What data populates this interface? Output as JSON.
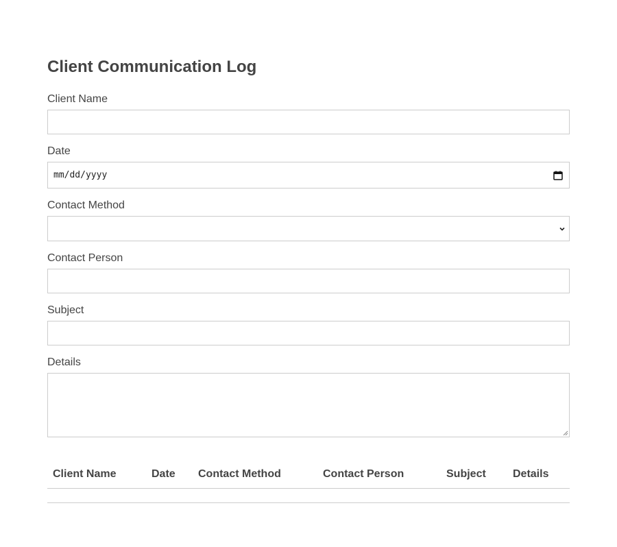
{
  "form": {
    "title": "Client Communication Log",
    "client_name_label": "Client Name",
    "client_name_value": "",
    "date_label": "Date",
    "date_placeholder": "mm/dd/yyyy",
    "contact_method_label": "Contact Method",
    "contact_method_value": "",
    "contact_person_label": "Contact Person",
    "contact_person_value": "",
    "subject_label": "Subject",
    "subject_value": "",
    "details_label": "Details",
    "details_value": ""
  },
  "table": {
    "headers": [
      "Client Name",
      "Date",
      "Contact Method",
      "Contact Person",
      "Subject",
      "Details"
    ],
    "rows": []
  },
  "icons": {
    "date_picker": "calendar-icon",
    "select": "chevron-down-icon",
    "textarea_resize": "resize-handle-icon"
  },
  "colors": {
    "text": "#444444",
    "border": "#cccccc",
    "background": "#ffffff"
  }
}
